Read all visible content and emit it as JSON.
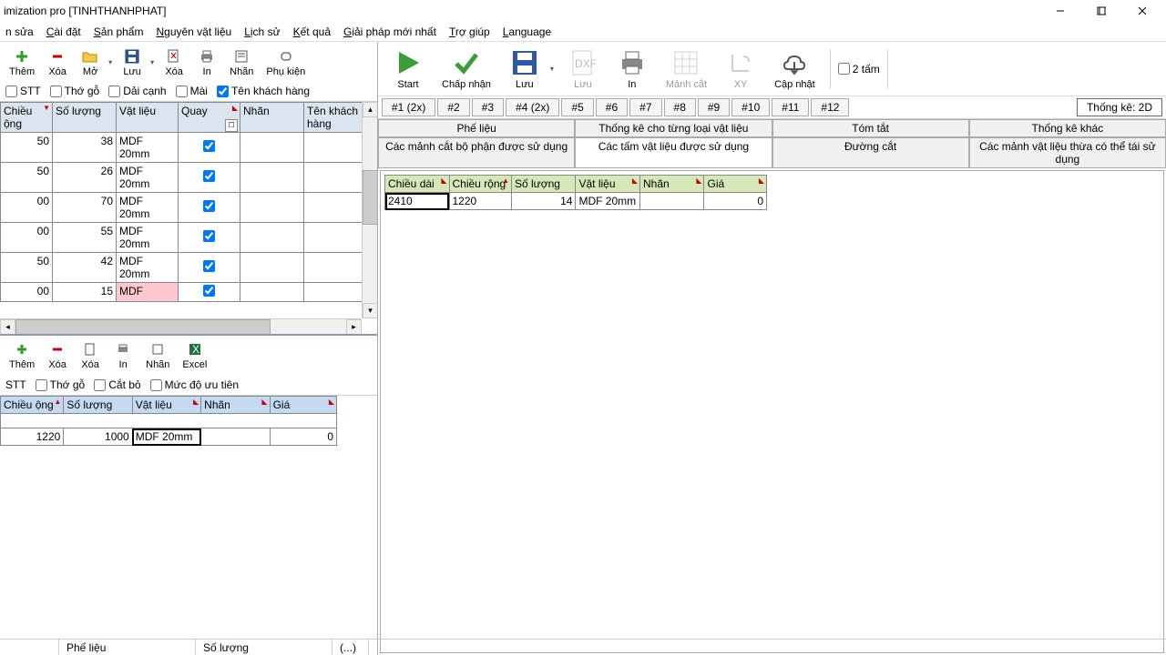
{
  "window": {
    "title": "imization pro [TINHTHANHPHAT]"
  },
  "menu": [
    "n sửa",
    "Cài đặt",
    "Sản phẩm",
    "Nguyên vật liệu",
    "Lịch sử",
    "Kết quả",
    "Giải pháp mới nhất",
    "Trợ giúp",
    "Language"
  ],
  "tb_left": {
    "them": "Thêm",
    "xoa": "Xóa",
    "mo": "Mở",
    "luu": "Lưu",
    "xoa2": "Xóa",
    "in": "In",
    "nhan": "Nhãn",
    "phukien": "Phụ kiện"
  },
  "check_row1": {
    "stt": "STT",
    "thogo": "Thớ gỗ",
    "daicanh": "Dải cạnh",
    "mai": "Mài",
    "tenkh": "Tên khách hàng"
  },
  "grid1": {
    "headers": {
      "chieu_ong": "Chiều ộng",
      "soluong": "Số lượng",
      "vatlieu": "Vật liệu",
      "quay": "Quay",
      "nhan": "Nhãn",
      "tenkh": "Tên khách hàng"
    },
    "rows": [
      {
        "a": "50",
        "sl": "38",
        "vl": "MDF 20mm",
        "q": true
      },
      {
        "a": "50",
        "sl": "26",
        "vl": "MDF 20mm",
        "q": true
      },
      {
        "a": "00",
        "sl": "70",
        "vl": "MDF 20mm",
        "q": true
      },
      {
        "a": "00",
        "sl": "55",
        "vl": "MDF 20mm",
        "q": true
      },
      {
        "a": "50",
        "sl": "42",
        "vl": "MDF 20mm",
        "q": true
      },
      {
        "a": "00",
        "sl": "15",
        "vl": "MDF",
        "q": true
      }
    ]
  },
  "tb_lower": {
    "them": "Thêm",
    "xoa": "Xóa",
    "xoa2": "Xóa",
    "in": "In",
    "nhan": "Nhãn",
    "excel": "Excel"
  },
  "check_row2": {
    "stt": "STT",
    "thogo": "Thớ gỗ",
    "catbo": "Cắt bỏ",
    "mucdo": "Mức độ ưu tiên"
  },
  "grid2": {
    "headers": {
      "chieu_ong": "Chiều ộng",
      "soluong": "Số lượng",
      "vatlieu": "Vật liệu",
      "nhan": "Nhãn",
      "gia": "Giá"
    },
    "row": {
      "a": "1220",
      "sl": "1000",
      "vl": "MDF 20mm",
      "nh": "",
      "gia": "0"
    }
  },
  "big_tb": {
    "start": "Start",
    "chapnhan": "Chấp nhận",
    "luu": "Lưu",
    "luu2": "Lưu",
    "in": "In",
    "manhcat": "Mảnh cắt",
    "xy": "XY",
    "capnhat": "Cập nhật",
    "haitam": "2 tấm"
  },
  "tabs": [
    "#1 (2x)",
    "#2",
    "#3",
    "#4 (2x)",
    "#5",
    "#6",
    "#7",
    "#8",
    "#9",
    "#10",
    "#11",
    "#12"
  ],
  "stats_tab": "Thống kê: 2D",
  "subtabs_top": [
    "Phế liệu",
    "Thống kê cho từng loại vật liệu",
    "Tóm tắt",
    "Thống kê khác"
  ],
  "subtabs_bot": [
    "Các mảnh cắt bộ phận được sử dụng",
    "Các tấm vật liệu được sử dụng",
    "Đường cắt",
    "Các mảnh vật liệu thừa có thể tái sử dụng"
  ],
  "grid3": {
    "headers": {
      "chieudai": "Chiều dài",
      "chieurong": "Chiều rộng",
      "soluong": "Số lượng",
      "vatlieu": "Vật liệu",
      "nhan": "Nhãn",
      "gia": "Giá"
    },
    "row": {
      "cd": "2410",
      "cr": "1220",
      "sl": "14",
      "vl": "MDF 20mm",
      "nh": "",
      "gia": "0"
    }
  },
  "status": {
    "phelieu": "Phế liệu",
    "soluong": "Số lượng",
    "paren": "(...)"
  }
}
